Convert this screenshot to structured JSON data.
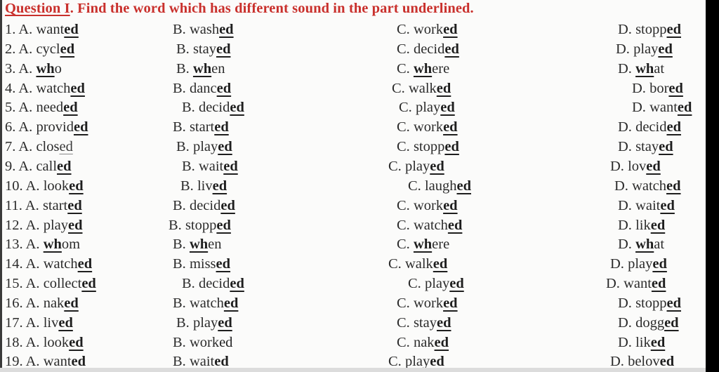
{
  "title": {
    "underlined": "Question I",
    "text": ". Find the word which has different sound in the part underlined."
  },
  "questions": [
    {
      "num": "1.",
      "options": [
        {
          "letter": "A.",
          "pre": "want",
          "hl": "ed",
          "post": ""
        },
        {
          "letter": "B.",
          "pre": "wash",
          "hl": "ed",
          "post": ""
        },
        {
          "letter": "C.",
          "pre": "work",
          "hl": "ed",
          "post": ""
        },
        {
          "letter": "D.",
          "pre": "stopp",
          "hl": "ed",
          "post": ""
        }
      ]
    },
    {
      "num": "2.",
      "options": [
        {
          "letter": "A.",
          "pre": "cycl",
          "hl": "ed",
          "post": ""
        },
        {
          "letter": "B.",
          "pre": "stay",
          "hl": "ed",
          "post": ""
        },
        {
          "letter": "C.",
          "pre": "decid",
          "hl": "ed",
          "post": ""
        },
        {
          "letter": "D.",
          "pre": "play",
          "hl": "ed",
          "post": ""
        }
      ]
    },
    {
      "num": "3.",
      "options": [
        {
          "letter": "A.",
          "pre": "",
          "hl": "wh",
          "post": "o"
        },
        {
          "letter": "B.",
          "pre": "",
          "hl": "wh",
          "post": "en"
        },
        {
          "letter": "C.",
          "pre": "",
          "hl": "wh",
          "post": "ere"
        },
        {
          "letter": "D.",
          "pre": "",
          "hl": "wh",
          "post": "at"
        }
      ]
    },
    {
      "num": "4.",
      "options": [
        {
          "letter": "A.",
          "pre": "watch",
          "hl": "ed",
          "post": ""
        },
        {
          "letter": "B.",
          "pre": "danc",
          "hl": "ed",
          "post": ""
        },
        {
          "letter": "C.",
          "pre": "walk",
          "hl": "ed",
          "post": ""
        },
        {
          "letter": "D.",
          "pre": "bor",
          "hl": "ed",
          "post": ""
        }
      ]
    },
    {
      "num": "5.",
      "options": [
        {
          "letter": "A.",
          "pre": "need",
          "hl": "ed",
          "post": ""
        },
        {
          "letter": "B.",
          "pre": "decid",
          "hl": "ed",
          "post": ""
        },
        {
          "letter": "C.",
          "pre": "play",
          "hl": "ed",
          "post": ""
        },
        {
          "letter": "D.",
          "pre": "want",
          "hl": "ed",
          "post": ""
        }
      ]
    },
    {
      "num": "6.",
      "options": [
        {
          "letter": "A.",
          "pre": "provid",
          "hl": "ed",
          "post": ""
        },
        {
          "letter": "B.",
          "pre": "start",
          "hl": "ed",
          "post": ""
        },
        {
          "letter": "C.",
          "pre": "work",
          "hl": "ed",
          "post": ""
        },
        {
          "letter": "D.",
          "pre": "decid",
          "hl": "ed",
          "post": ""
        }
      ]
    },
    {
      "num": "7.",
      "options": [
        {
          "letter": "A.",
          "pre": "clos",
          "hl": "ed",
          "post": "",
          "style": "faint"
        },
        {
          "letter": "B.",
          "pre": "play",
          "hl": "ed",
          "post": ""
        },
        {
          "letter": "C.",
          "pre": "stopp",
          "hl": "ed",
          "post": ""
        },
        {
          "letter": "D.",
          "pre": "stay",
          "hl": "ed",
          "post": ""
        }
      ]
    },
    {
      "num": "9.",
      "options": [
        {
          "letter": "A.",
          "pre": "call",
          "hl": "ed",
          "post": ""
        },
        {
          "letter": "B.",
          "pre": "wait",
          "hl": "ed",
          "post": ""
        },
        {
          "letter": "C.",
          "pre": "play",
          "hl": "ed",
          "post": ""
        },
        {
          "letter": "D.",
          "pre": "lov",
          "hl": "ed",
          "post": ""
        }
      ]
    },
    {
      "num": "10.",
      "options": [
        {
          "letter": "A.",
          "pre": "look",
          "hl": "ed",
          "post": ""
        },
        {
          "letter": "B.",
          "pre": "liv",
          "hl": "ed",
          "post": ""
        },
        {
          "letter": "C.",
          "pre": "laugh",
          "hl": "ed",
          "post": ""
        },
        {
          "letter": "D.",
          "pre": "watch",
          "hl": "ed",
          "post": ""
        }
      ]
    },
    {
      "num": "11.",
      "options": [
        {
          "letter": "A.",
          "pre": "start",
          "hl": "ed",
          "post": ""
        },
        {
          "letter": "B.",
          "pre": "decid",
          "hl": "ed",
          "post": ""
        },
        {
          "letter": "C.",
          "pre": "work",
          "hl": "ed",
          "post": ""
        },
        {
          "letter": "D.",
          "pre": "wait",
          "hl": "ed",
          "post": ""
        }
      ]
    },
    {
      "num": "12.",
      "options": [
        {
          "letter": "A.",
          "pre": "play",
          "hl": "ed",
          "post": ""
        },
        {
          "letter": "B.",
          "pre": "stopp",
          "hl": "ed",
          "post": ""
        },
        {
          "letter": "C.",
          "pre": "watch",
          "hl": "ed",
          "post": ""
        },
        {
          "letter": "D.",
          "pre": "lik",
          "hl": "ed",
          "post": ""
        }
      ]
    },
    {
      "num": "13.",
      "options": [
        {
          "letter": "A.",
          "pre": "",
          "hl": "wh",
          "post": "om"
        },
        {
          "letter": "B.",
          "pre": "",
          "hl": "wh",
          "post": "en"
        },
        {
          "letter": "C.",
          "pre": "",
          "hl": "wh",
          "post": "ere"
        },
        {
          "letter": "D.",
          "pre": "",
          "hl": "wh",
          "post": "at"
        }
      ]
    },
    {
      "num": "14.",
      "options": [
        {
          "letter": "A.",
          "pre": "watch",
          "hl": "ed",
          "post": ""
        },
        {
          "letter": "B.",
          "pre": "miss",
          "hl": "ed",
          "post": ""
        },
        {
          "letter": "C.",
          "pre": "walk",
          "hl": "ed",
          "post": ""
        },
        {
          "letter": "D.",
          "pre": "play",
          "hl": "ed",
          "post": ""
        }
      ]
    },
    {
      "num": "15.",
      "options": [
        {
          "letter": "A.",
          "pre": "collect",
          "hl": "ed",
          "post": ""
        },
        {
          "letter": "B.",
          "pre": "decid",
          "hl": "ed",
          "post": ""
        },
        {
          "letter": "C.",
          "pre": "play",
          "hl": "ed",
          "post": ""
        },
        {
          "letter": "D.",
          "pre": "want",
          "hl": "ed",
          "post": ""
        }
      ]
    },
    {
      "num": "16.",
      "options": [
        {
          "letter": "A.",
          "pre": "nak",
          "hl": "ed",
          "post": ""
        },
        {
          "letter": "B.",
          "pre": "watch",
          "hl": "ed",
          "post": ""
        },
        {
          "letter": "C.",
          "pre": "work",
          "hl": "ed",
          "post": ""
        },
        {
          "letter": "D.",
          "pre": "stopp",
          "hl": "ed",
          "post": ""
        }
      ]
    },
    {
      "num": "17.",
      "options": [
        {
          "letter": "A.",
          "pre": "liv",
          "hl": "ed",
          "post": ""
        },
        {
          "letter": "B.",
          "pre": "play",
          "hl": "ed",
          "post": ""
        },
        {
          "letter": "C.",
          "pre": "stay",
          "hl": "ed",
          "post": ""
        },
        {
          "letter": "D.",
          "pre": "dogg",
          "hl": "ed",
          "post": ""
        }
      ]
    },
    {
      "num": "18.",
      "options": [
        {
          "letter": "A.",
          "pre": "look",
          "hl": "ed",
          "post": ""
        },
        {
          "letter": "B.",
          "pre": "work",
          "hl": "ed",
          "post": "",
          "style": "none"
        },
        {
          "letter": "C.",
          "pre": "nak",
          "hl": "ed",
          "post": ""
        },
        {
          "letter": "D.",
          "pre": "lik",
          "hl": "ed",
          "post": ""
        }
      ]
    },
    {
      "num": "19.",
      "options": [
        {
          "letter": "A.",
          "pre": "want",
          "hl": "ed",
          "post": ""
        },
        {
          "letter": "B.",
          "pre": "wait",
          "hl": "ed",
          "post": ""
        },
        {
          "letter": "C.",
          "pre": "play",
          "hl": "ed",
          "post": ""
        },
        {
          "letter": "D.",
          "pre": "belov",
          "hl": "ed",
          "post": ""
        }
      ]
    }
  ]
}
